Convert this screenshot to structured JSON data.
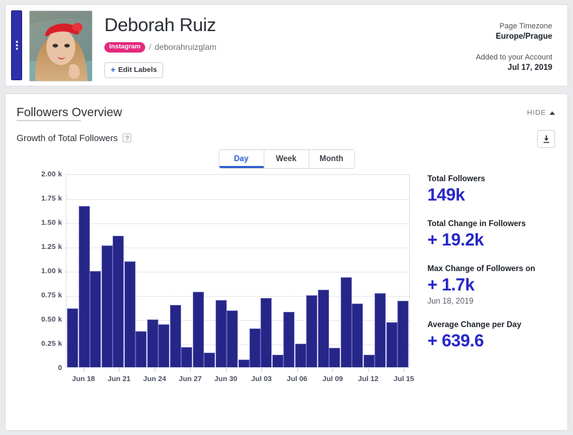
{
  "profile": {
    "name": "Deborah Ruiz",
    "platform_badge": "Instagram",
    "handle_separator": "/",
    "handle": "deborahruizglam",
    "edit_labels_plus": "+",
    "edit_labels": "Edit Labels",
    "timezone_label": "Page Timezone",
    "timezone_value": "Europe/Prague",
    "added_label": "Added to your Account",
    "added_value": "Jul 17, 2019"
  },
  "overview": {
    "title": "Followers Overview",
    "hide_label": "HIDE",
    "subtitle": "Growth of Total Followers",
    "help": "?",
    "download_icon": "download-icon",
    "tabs": [
      {
        "label": "Day",
        "active": true
      },
      {
        "label": "Week",
        "active": false
      },
      {
        "label": "Month",
        "active": false
      }
    ]
  },
  "stats": [
    {
      "title": "Total Followers",
      "value": "149k",
      "sub": ""
    },
    {
      "title": "Total Change in Followers",
      "value": "+ 19.2k",
      "sub": ""
    },
    {
      "title": "Max Change of Followers on",
      "value": "+ 1.7k",
      "sub": "Jun 18, 2019"
    },
    {
      "title": "Average Change per Day",
      "value": "+ 639.6",
      "sub": ""
    }
  ],
  "chart_data": {
    "type": "bar",
    "title": "Growth of Total Followers",
    "xlabel": "",
    "ylabel": "",
    "ylim": [
      0,
      2000
    ],
    "grid": true,
    "legend": null,
    "ytick_values": [
      0,
      250,
      500,
      750,
      1000,
      1250,
      1500,
      1750,
      2000
    ],
    "ytick_labels": [
      "0",
      "0.25 k",
      "0.50 k",
      "0.75 k",
      "1.00 k",
      "1.25 k",
      "1.50 k",
      "1.75 k",
      "2.00 k"
    ],
    "xtick_labels": [
      "Jun 18",
      "Jun 21",
      "Jun 24",
      "Jun 27",
      "Jun 30",
      "Jul 03",
      "Jul 06",
      "Jul 09",
      "Jul 12",
      "Jul 15"
    ],
    "xtick_indices": [
      1,
      4,
      7,
      10,
      13,
      16,
      19,
      22,
      25,
      28
    ],
    "categories": [
      "Jun 17",
      "Jun 18",
      "Jun 19",
      "Jun 20",
      "Jun 21",
      "Jun 22",
      "Jun 23",
      "Jun 24",
      "Jun 25",
      "Jun 26",
      "Jun 27",
      "Jun 28",
      "Jun 29",
      "Jun 30",
      "Jul 01",
      "Jul 02",
      "Jul 03",
      "Jul 04",
      "Jul 05",
      "Jul 06",
      "Jul 07",
      "Jul 08",
      "Jul 09",
      "Jul 10",
      "Jul 11",
      "Jul 12",
      "Jul 13",
      "Jul 14",
      "Jul 15",
      "Jul 16"
    ],
    "values": [
      605,
      1663,
      993,
      1260,
      1360,
      1095,
      374,
      491,
      446,
      642,
      205,
      776,
      153,
      695,
      584,
      77,
      398,
      714,
      128,
      574,
      240,
      742,
      797,
      200,
      930,
      656,
      128,
      765,
      467,
      688
    ],
    "bar_color": "#262688",
    "bar_edge_color": "#5a5ab4"
  },
  "colors": {
    "accent_blue": "#2f5ed4",
    "value_blue": "#2626c6",
    "instagram_pink": "#e5287e",
    "handle_bar": "#2f2fa8"
  }
}
